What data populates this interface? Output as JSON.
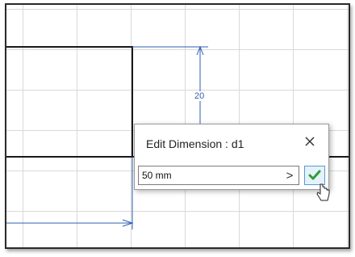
{
  "canvas": {
    "dimension_value_label": "20"
  },
  "dialog": {
    "title": "Edit Dimension : d1",
    "input_value": "50 mm",
    "next_label": ">",
    "close_icon": "close-icon",
    "ok_icon": "checkmark-icon"
  },
  "colors": {
    "dimension_blue": "#2c5fb3",
    "ok_green": "#2e9e3a",
    "ok_border": "#5a9acb"
  }
}
